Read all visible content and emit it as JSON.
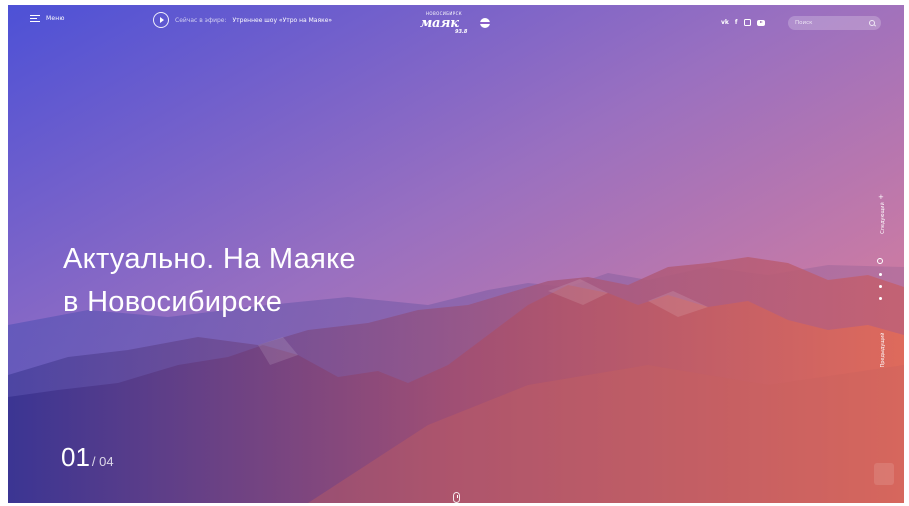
{
  "header": {
    "menu_label": "Меню",
    "live_prefix": "Сейчас в эфире:",
    "live_show": "Утреннее шоу «Утро на Маяке»",
    "logo": {
      "city": "НОВОСИБИРСК",
      "name": "маяк",
      "frequency": "93.8"
    },
    "social": {
      "vk": "vk",
      "facebook": "f",
      "instagram": "instagram-icon",
      "youtube": "youtube-icon"
    },
    "search_placeholder": "Поиск"
  },
  "hero": {
    "headline_line1": "Актуально. На Маяке",
    "headline_line2": "в Новосибирске",
    "slide_current": "01",
    "slide_total": "/ 04"
  },
  "side_nav": {
    "next_label": "Следующий",
    "prev_label": "Предыдущий",
    "dots_count": 4,
    "active_dot": 1
  },
  "colors": {
    "gradient_left": "#4a4fd2",
    "gradient_right": "#e8706a",
    "text": "#ffffff"
  }
}
